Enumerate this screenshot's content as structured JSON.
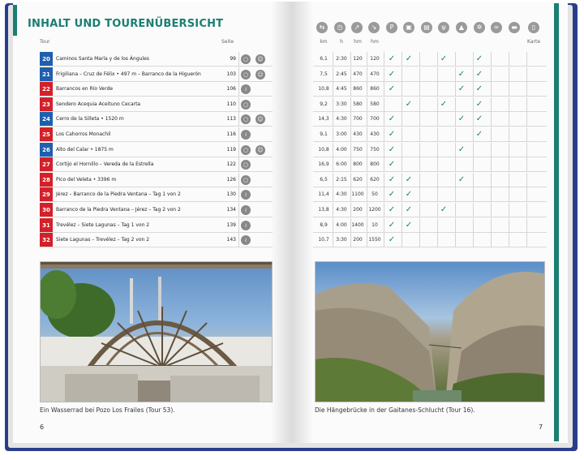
{
  "title": "INHALT UND TOURENÜBERSICHT",
  "left_headers": {
    "tour": "Tour",
    "page": "Seite"
  },
  "right_headers": {
    "km": "km",
    "h": "h",
    "hm_up": "hm",
    "hm_down": "hm",
    "map": "Karte"
  },
  "right_icons": [
    "bus-stop-icon",
    "clock-icon",
    "ascent-icon",
    "descent-icon",
    "parking-icon",
    "bus-icon",
    "train-icon",
    "restaurant-icon",
    "hut-icon",
    "winter-icon",
    "bike-icon",
    "cable-car-icon",
    "map-book-icon"
  ],
  "colors": {
    "teal": "#1a7f72",
    "blue": "#1f5fad",
    "red": "#d3202a",
    "icon_gray": "#8a8a8a"
  },
  "tours": [
    {
      "num": "20",
      "name": "Caminos Santa María y de los Ángules",
      "page": "99",
      "color": "blue",
      "km": "6,1",
      "h": "2:30",
      "up": "120",
      "down": "120",
      "checks": [
        0,
        1,
        3,
        5
      ],
      "icons": [
        "loop",
        "kid"
      ]
    },
    {
      "num": "21",
      "name": "Frigiliana – Cruz de Félix • 497 m – Barranco de la Higuerón",
      "page": "103",
      "color": "blue",
      "km": "7,5",
      "h": "2:45",
      "up": "470",
      "down": "470",
      "checks": [
        0,
        4,
        5
      ],
      "icons": [
        "loop",
        "kid"
      ]
    },
    {
      "num": "22",
      "name": "Barrancos en Río Verde",
      "page": "106",
      "color": "red",
      "km": "10,8",
      "h": "4:45",
      "up": "860",
      "down": "860",
      "checks": [
        0,
        4,
        5
      ],
      "icons": [
        "line"
      ]
    },
    {
      "num": "23",
      "name": "Sendero Acequia Aceituno Cecarta",
      "page": "110",
      "color": "red",
      "km": "9,2",
      "h": "3:30",
      "up": "580",
      "down": "580",
      "checks": [
        1,
        3,
        5
      ],
      "icons": [
        "loop"
      ]
    },
    {
      "num": "24",
      "name": "Cerro de la Silleta • 1520 m",
      "page": "113",
      "color": "blue",
      "km": "14,3",
      "h": "4:30",
      "up": "700",
      "down": "700",
      "checks": [
        0,
        4,
        5
      ],
      "icons": [
        "loop",
        "kid"
      ]
    },
    {
      "num": "25",
      "name": "Los Cahorros Monachil",
      "page": "116",
      "color": "red",
      "km": "9,1",
      "h": "3:00",
      "up": "430",
      "down": "430",
      "checks": [
        0,
        5
      ],
      "icons": [
        "line"
      ]
    },
    {
      "num": "26",
      "name": "Alto del Calar • 1875 m",
      "page": "119",
      "color": "blue",
      "km": "10,8",
      "h": "4:00",
      "up": "750",
      "down": "750",
      "checks": [
        0,
        4
      ],
      "icons": [
        "loop",
        "kid"
      ]
    },
    {
      "num": "27",
      "name": "Cortijo el Hornillo – Vereda de la Estrella",
      "page": "122",
      "color": "red",
      "km": "16,9",
      "h": "6:00",
      "up": "800",
      "down": "800",
      "checks": [
        0
      ],
      "icons": [
        "loop"
      ]
    },
    {
      "num": "28",
      "name": "Pico del Veleta • 3396 m",
      "page": "126",
      "color": "red",
      "km": "6,5",
      "h": "2:15",
      "up": "620",
      "down": "620",
      "checks": [
        0,
        1,
        4
      ],
      "icons": [
        "loop"
      ]
    },
    {
      "num": "29",
      "name": "Jérez – Barranco de la Piedra Ventana – Tag 1 von 2",
      "page": "130",
      "color": "red",
      "km": "11,4",
      "h": "4:30",
      "up": "1100",
      "down": "50",
      "checks": [
        0,
        1
      ],
      "icons": [
        "line"
      ]
    },
    {
      "num": "30",
      "name": "Barranco de la Piedra Ventana – Jérez – Tag 2 von 2",
      "page": "134",
      "color": "red",
      "km": "13,8",
      "h": "4:30",
      "up": "200",
      "down": "1200",
      "checks": [
        0,
        1,
        3
      ],
      "icons": [
        "line"
      ]
    },
    {
      "num": "31",
      "name": "Trevélez – Siete Lagunas – Tag 1 von 2",
      "page": "139",
      "color": "red",
      "km": "8,9",
      "h": "4:00",
      "up": "1400",
      "down": "10",
      "checks": [
        0,
        1
      ],
      "icons": [
        "line"
      ]
    },
    {
      "num": "32",
      "name": "Siete Lagunas – Trevélez – Tag 2 von 2",
      "page": "143",
      "color": "red",
      "km": "10,7",
      "h": "3:30",
      "up": "200",
      "down": "1550",
      "checks": [
        0
      ],
      "icons": [
        "line"
      ]
    }
  ],
  "captions": {
    "left": "Ein Wasserrad bei Pozo Los Frailes (Tour 53).",
    "right": "Die Hängebrücke in der Gaitanes-Schlucht (Tour 16)."
  },
  "page_numbers": {
    "left": "6",
    "right": "7"
  }
}
